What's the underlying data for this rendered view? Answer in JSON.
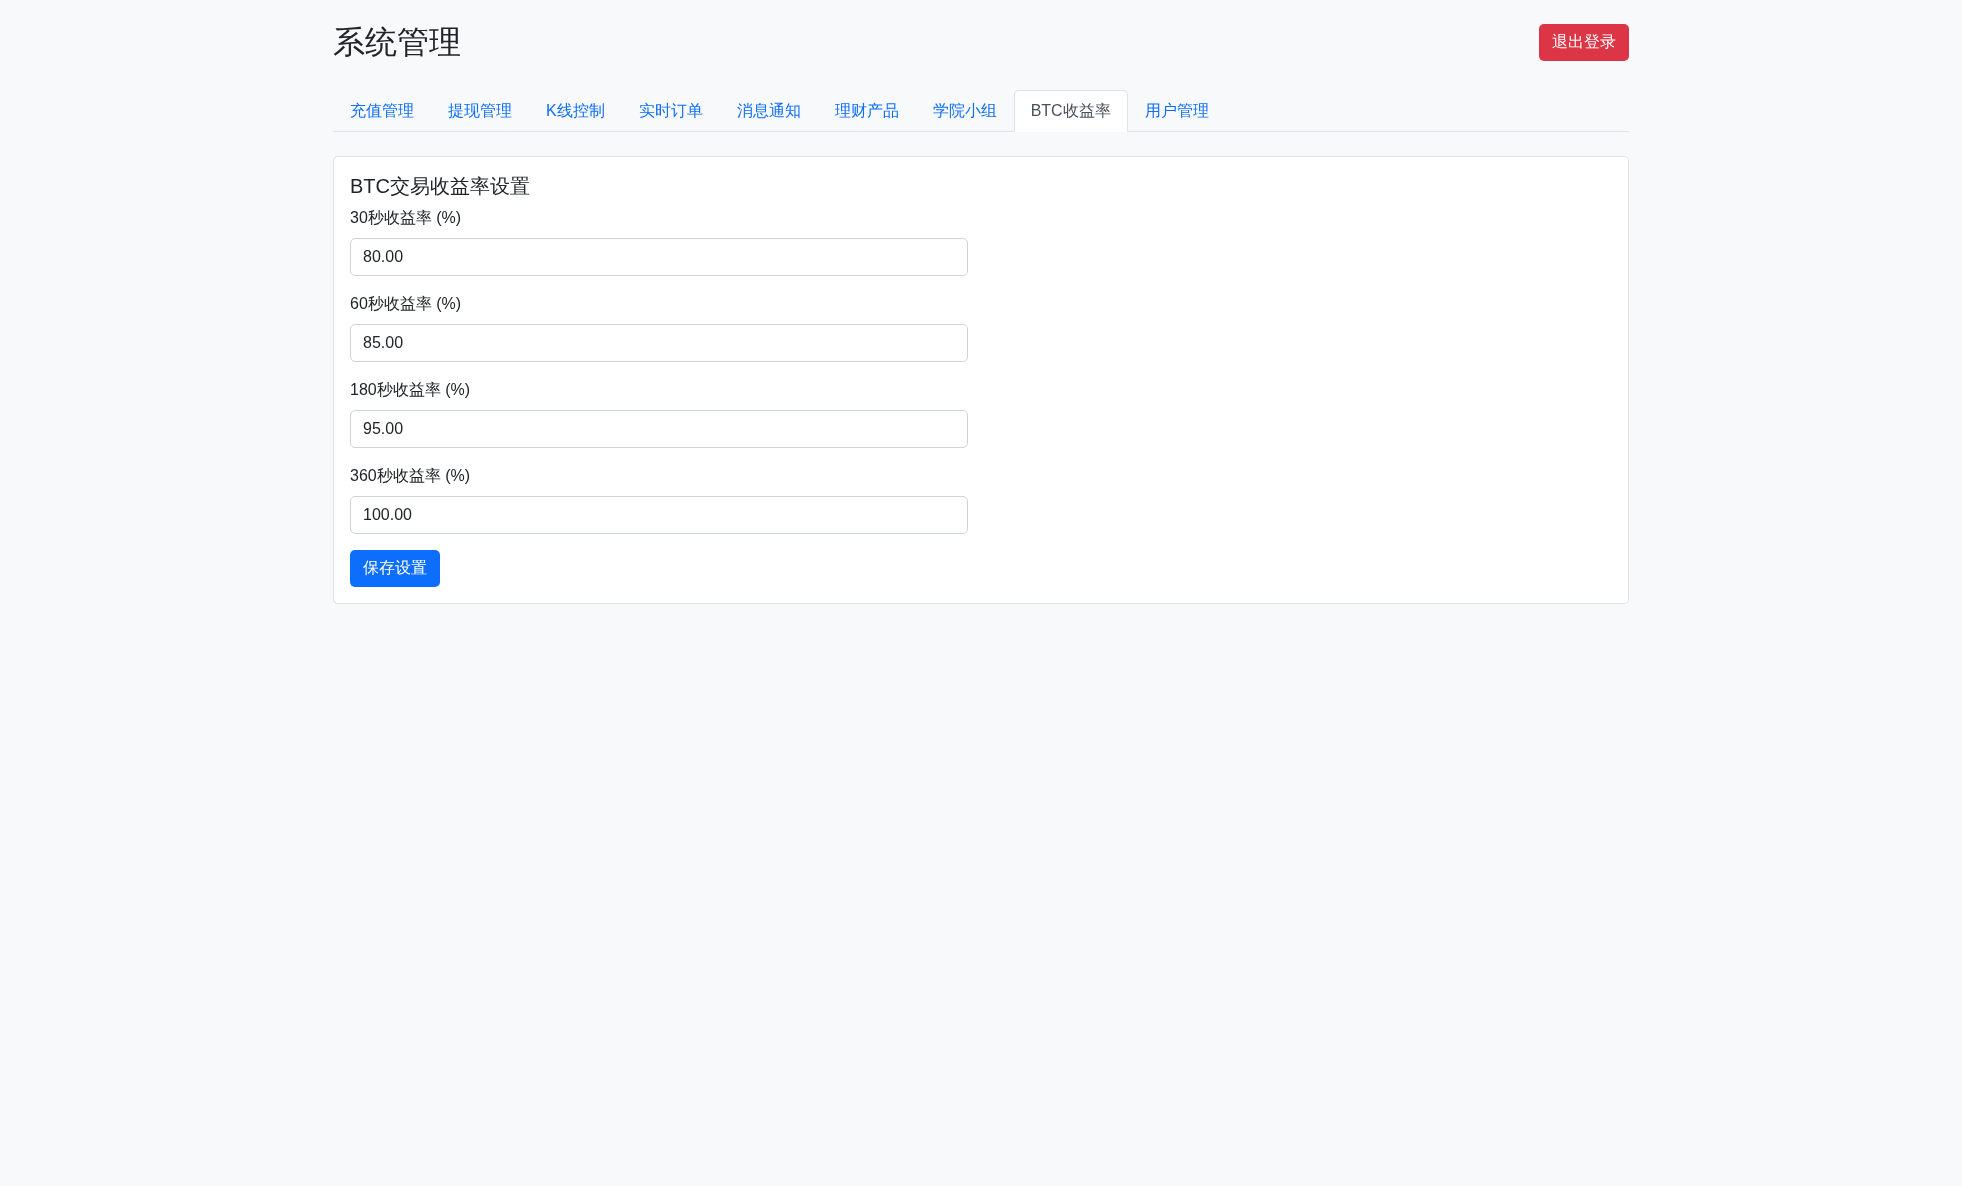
{
  "header": {
    "title": "系统管理",
    "logout_button": "退出登录"
  },
  "tabs": [
    {
      "label": "充值管理",
      "selected": false
    },
    {
      "label": "提现管理",
      "selected": false
    },
    {
      "label": "K线控制",
      "selected": false
    },
    {
      "label": "实时订单",
      "selected": false
    },
    {
      "label": "消息通知",
      "selected": false
    },
    {
      "label": "理财产品",
      "selected": false
    },
    {
      "label": "学院小组",
      "selected": false
    },
    {
      "label": "BTC收益率",
      "selected": true
    },
    {
      "label": "用户管理",
      "selected": false
    }
  ],
  "card": {
    "title": "BTC交易收益率设置",
    "fields": [
      {
        "label": "30秒收益率 (%)",
        "value": "80.00"
      },
      {
        "label": "60秒收益率 (%)",
        "value": "85.00"
      },
      {
        "label": "180秒收益率 (%)",
        "value": "95.00"
      },
      {
        "label": "360秒收益率 (%)",
        "value": "100.00"
      }
    ],
    "save_button": "保存设置"
  }
}
